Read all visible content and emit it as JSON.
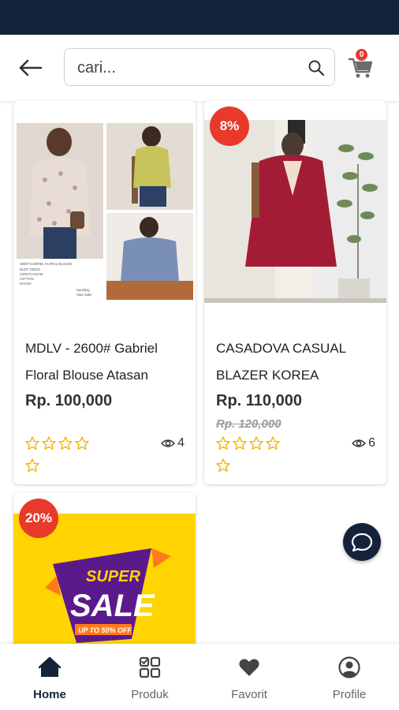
{
  "search": {
    "placeholder": "cari..."
  },
  "cart": {
    "count": "0"
  },
  "products": [
    {
      "title": "MDLV - 2600# Gabriel Floral Blouse Atasan",
      "price": "Rp. 100,000",
      "old_price": "",
      "discount": "",
      "views": "4",
      "rating": 0,
      "image_caption": "2600# GABRIEL FLORAL BLOUSE\nBUST 100CM\nLENGTH 62CM\nCOTTON\nRAYON",
      "image_note": "Nanaling\nStaa Saku"
    },
    {
      "title": "CASADOVA CASUAL BLAZER KOREA",
      "price": "Rp. 110,000",
      "old_price": "Rp. 120,000",
      "discount": "8%",
      "views": "6",
      "rating": 0
    },
    {
      "discount": "20%",
      "promo": {
        "line1": "SUPER",
        "line2": "SALE",
        "line3": "UP TO 50% OFF"
      }
    }
  ],
  "nav": [
    {
      "label": "Home",
      "icon": "home-icon",
      "active": true
    },
    {
      "label": "Produk",
      "icon": "grid-icon",
      "active": false
    },
    {
      "label": "Favorit",
      "icon": "heart-icon",
      "active": false
    },
    {
      "label": "Profile",
      "icon": "profile-icon",
      "active": false
    }
  ],
  "colors": {
    "primary": "#15233a",
    "discount": "#e8392a",
    "star": "#f5b400",
    "promo_yellow": "#ffd400",
    "promo_purple": "#5b1a8c"
  }
}
